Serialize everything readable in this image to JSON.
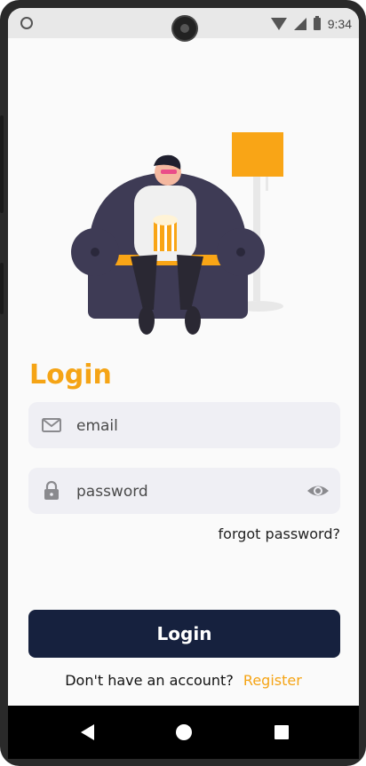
{
  "status_bar": {
    "time": "9:34"
  },
  "illustration": {
    "icon": "person-on-sofa-illustration"
  },
  "login_form": {
    "title": "Login",
    "email": {
      "placeholder": "email",
      "value": "",
      "icon": "mail-icon"
    },
    "password": {
      "placeholder": "password",
      "value": "",
      "icon": "lock-icon",
      "toggle_icon": "eye-icon"
    },
    "forgot_label": "forgot password?",
    "submit_label": "Login",
    "register_question": "Don't have an account?",
    "register_link": "Register"
  },
  "nav_bar": {
    "back_icon": "back-triangle-icon",
    "home_icon": "home-circle-icon",
    "recents_icon": "recents-square-icon"
  },
  "colors": {
    "accent": "#f5a415",
    "button": "#16213e",
    "field_bg": "#efeff4",
    "background": "#fafafa"
  }
}
